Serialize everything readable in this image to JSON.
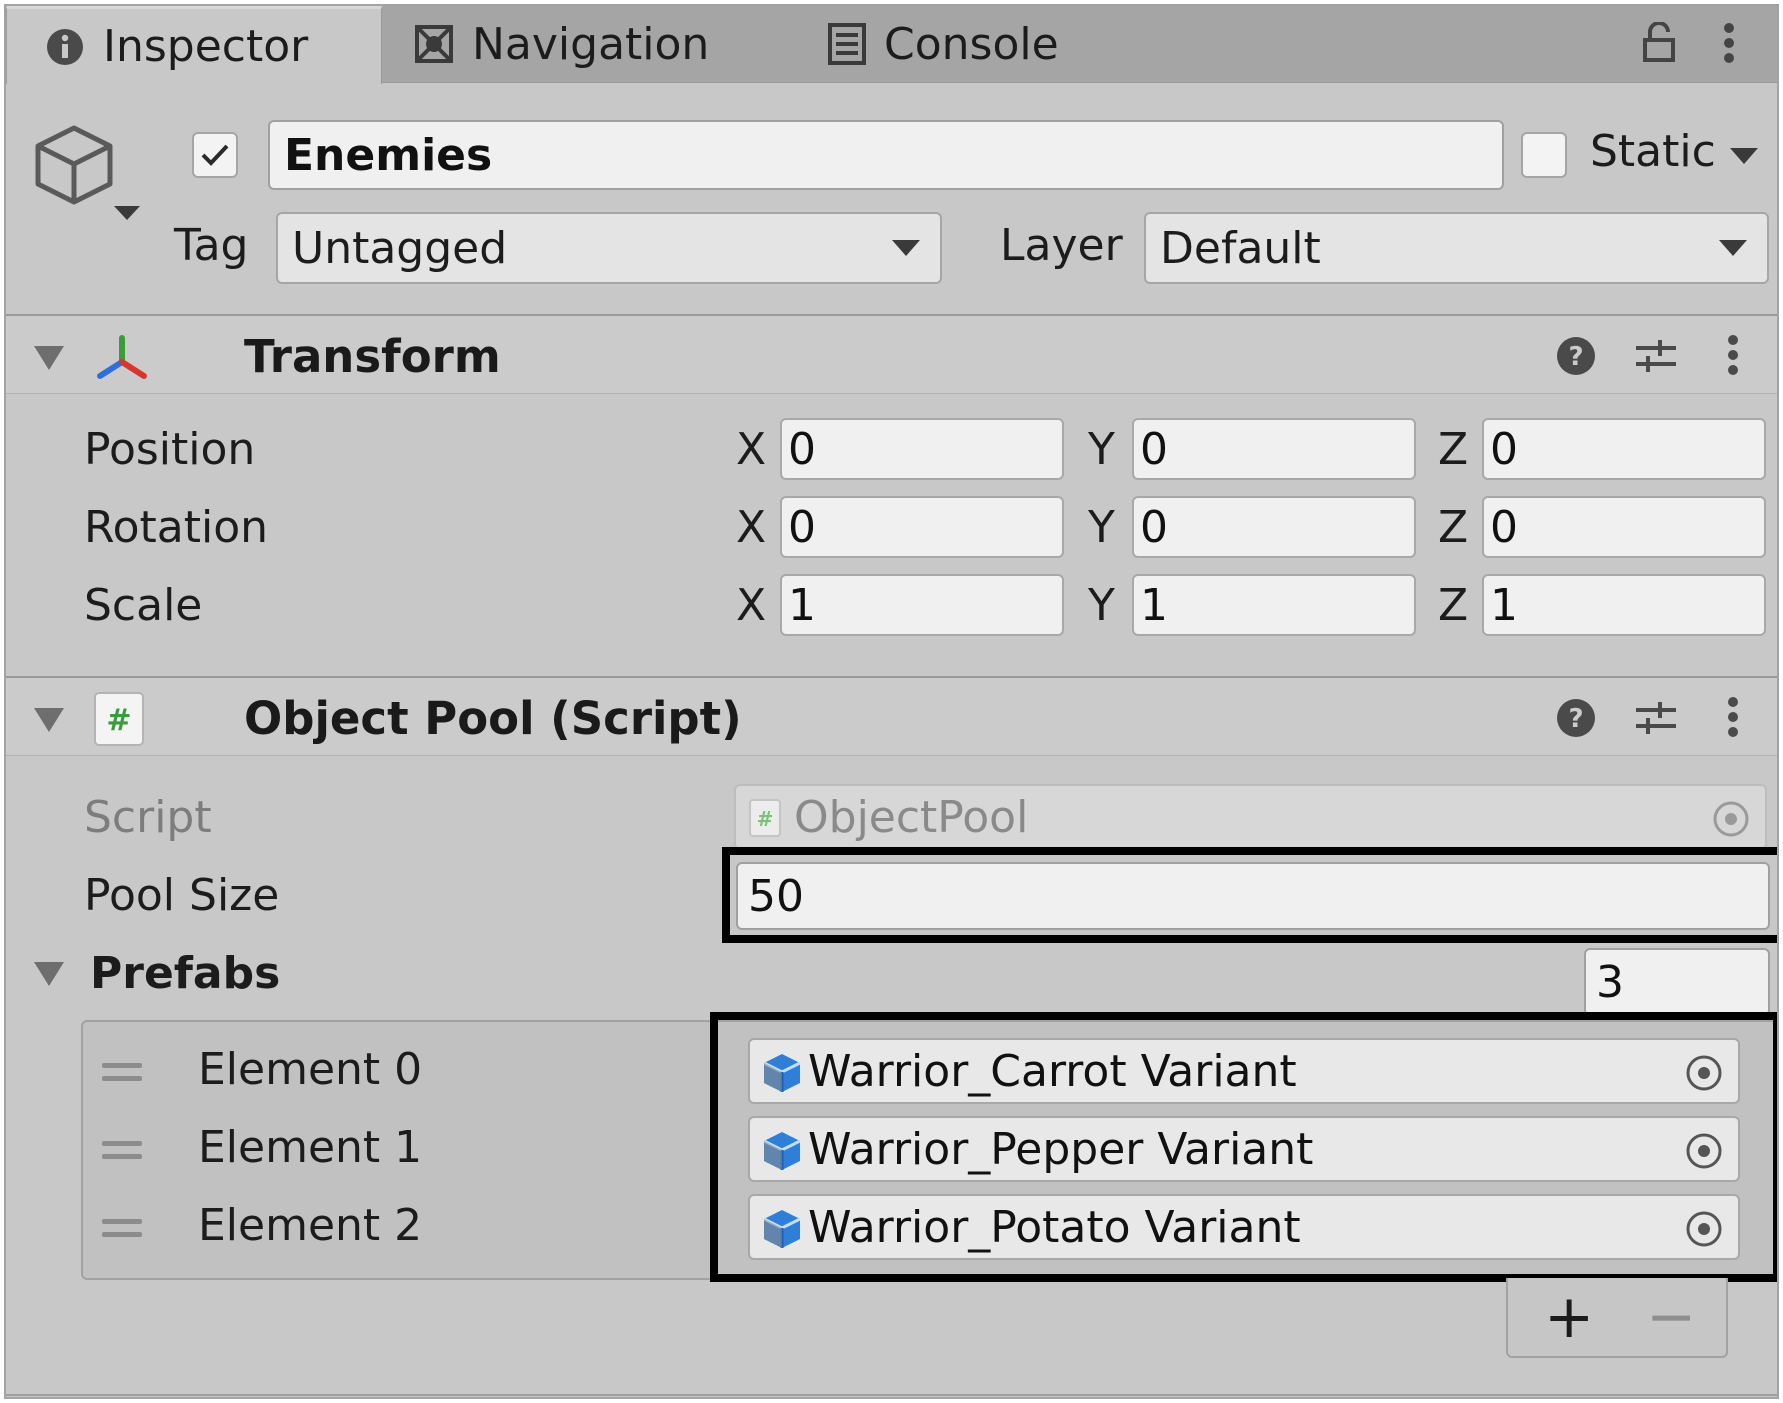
{
  "tabs": [
    {
      "label": "Inspector",
      "icon": "info-icon",
      "active": true
    },
    {
      "label": "Navigation",
      "icon": "navigation-icon",
      "active": false
    },
    {
      "label": "Console",
      "icon": "console-icon",
      "active": false
    }
  ],
  "header": {
    "active": true,
    "name": "Enemies",
    "static_label": "Static",
    "static_checked": false,
    "tag_label": "Tag",
    "tag_value": "Untagged",
    "layer_label": "Layer",
    "layer_value": "Default"
  },
  "transform": {
    "title": "Transform",
    "rows": [
      {
        "label": "Position",
        "x": "0",
        "y": "0",
        "z": "0"
      },
      {
        "label": "Rotation",
        "x": "0",
        "y": "0",
        "z": "0"
      },
      {
        "label": "Scale",
        "x": "1",
        "y": "1",
        "z": "1"
      }
    ],
    "axes": {
      "x": "X",
      "y": "Y",
      "z": "Z"
    }
  },
  "object_pool": {
    "title": "Object Pool (Script)",
    "script_label": "Script",
    "script_value": "ObjectPool",
    "pool_size_label": "Pool Size",
    "pool_size_value": "50",
    "prefabs_label": "Prefabs",
    "prefabs_count": "3",
    "elements": [
      {
        "label": "Element 0",
        "value": "Warrior_Carrot Variant"
      },
      {
        "label": "Element 1",
        "value": "Warrior_Pepper Variant"
      },
      {
        "label": "Element 2",
        "value": "Warrior_Potato Variant"
      }
    ],
    "add_symbol": "+",
    "remove_symbol": "−"
  },
  "colors": {
    "panel_bg": "#c8c8c8",
    "tab_bar_bg": "#a5a5a5",
    "field_bg": "#f0f0f0",
    "highlight_border": "#000000",
    "script_icon_green": "#3c9c3c",
    "prefab_icon_blue": "#2f7fd8"
  }
}
